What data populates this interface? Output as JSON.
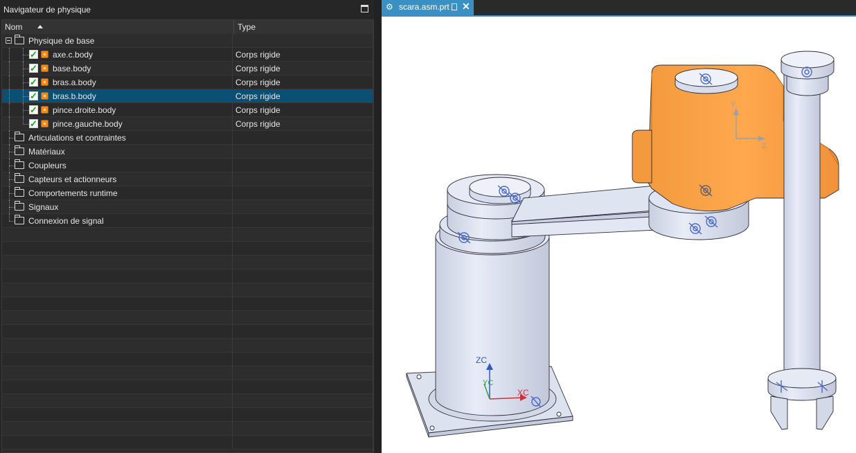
{
  "navigator": {
    "title": "Navigateur de physique",
    "columns": {
      "name": "Nom",
      "type": "Type"
    },
    "rows": [
      {
        "label": "Physique de base",
        "type": ""
      },
      {
        "label": "axe.c.body",
        "type": "Corps rigide"
      },
      {
        "label": "base.body",
        "type": "Corps rigide"
      },
      {
        "label": "bras.a.body",
        "type": "Corps rigide"
      },
      {
        "label": "bras.b.body",
        "type": "Corps rigide"
      },
      {
        "label": "pince.droite.body",
        "type": "Corps rigide"
      },
      {
        "label": "pince.gauche.body",
        "type": "Corps rigide"
      },
      {
        "label": "Articulations et contraintes",
        "type": ""
      },
      {
        "label": "Matériaux",
        "type": ""
      },
      {
        "label": "Coupleurs",
        "type": ""
      },
      {
        "label": "Capteurs et actionneurs",
        "type": ""
      },
      {
        "label": "Comportements runtime",
        "type": ""
      },
      {
        "label": "Signaux",
        "type": ""
      },
      {
        "label": "Connexion de signal",
        "type": ""
      }
    ],
    "selected_row": "bras.b.body"
  },
  "tab": {
    "label": "scara.asm.prt"
  },
  "viewport": {
    "axes_labels": {
      "zc": "ZC",
      "yc": "YC",
      "xc": "XC",
      "y": "Y",
      "z": "Z"
    },
    "colors": {
      "highlight": "#ffa246",
      "body": "#dfe4f2",
      "edge": "#2c2c38",
      "marker": "#4a68c8"
    }
  }
}
